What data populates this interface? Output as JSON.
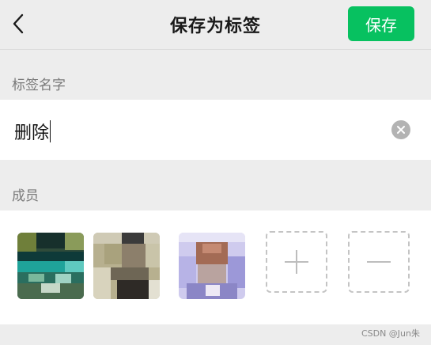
{
  "header": {
    "title": "保存为标签",
    "save_label": "保存",
    "back_icon": "chevron-left-icon"
  },
  "tag_name": {
    "label": "标签名字",
    "value": "删除",
    "clear_icon": "clear-circle-icon"
  },
  "members": {
    "label": "成员",
    "avatars": [
      {
        "name": "member-avatar-1"
      },
      {
        "name": "member-avatar-2"
      },
      {
        "name": "member-avatar-3"
      }
    ],
    "add_icon": "plus-icon",
    "remove_icon": "minus-icon"
  },
  "watermark": "CSDN @Jun朱",
  "colors": {
    "accent": "#07c160",
    "background": "#ededed",
    "surface": "#ffffff"
  }
}
